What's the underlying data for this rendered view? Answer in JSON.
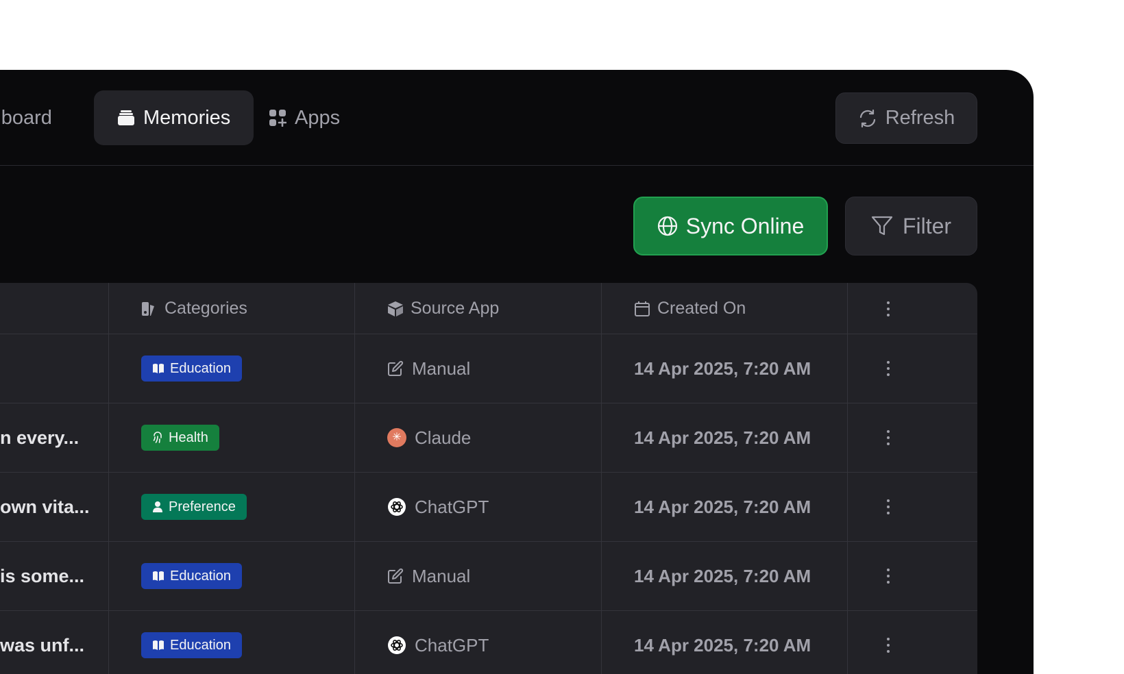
{
  "nav": {
    "tabs": [
      {
        "label": "Dashboard",
        "icon": "dashboard-icon"
      },
      {
        "label": "Memories",
        "icon": "memories-icon",
        "active": true
      },
      {
        "label": "Apps",
        "icon": "apps-icon"
      }
    ],
    "refresh_label": "Refresh"
  },
  "toolbar": {
    "sync_label": "Sync Online",
    "filter_label": "Filter"
  },
  "table": {
    "headers": {
      "categories": "Categories",
      "source_app": "Source App",
      "created_on": "Created On"
    },
    "rows": [
      {
        "memory": "",
        "category": "Education",
        "source": "Manual",
        "created": "14 Apr 2025, 7:20 AM"
      },
      {
        "memory": "n every...",
        "category": "Health",
        "source": "Claude",
        "created": "14 Apr 2025, 7:20 AM"
      },
      {
        "memory": "own vita...",
        "category": "Preference",
        "source": "ChatGPT",
        "created": "14 Apr 2025, 7:20 AM"
      },
      {
        "memory": "is some...",
        "category": "Education",
        "source": "Manual",
        "created": "14 Apr 2025, 7:20 AM"
      },
      {
        "memory": "was unf...",
        "category": "Education",
        "source": "ChatGPT",
        "created": "14 Apr 2025, 7:20 AM"
      }
    ]
  },
  "colors": {
    "education": "#1e40af",
    "health": "#15803d",
    "preference": "#047857",
    "sync": "#15803d"
  }
}
